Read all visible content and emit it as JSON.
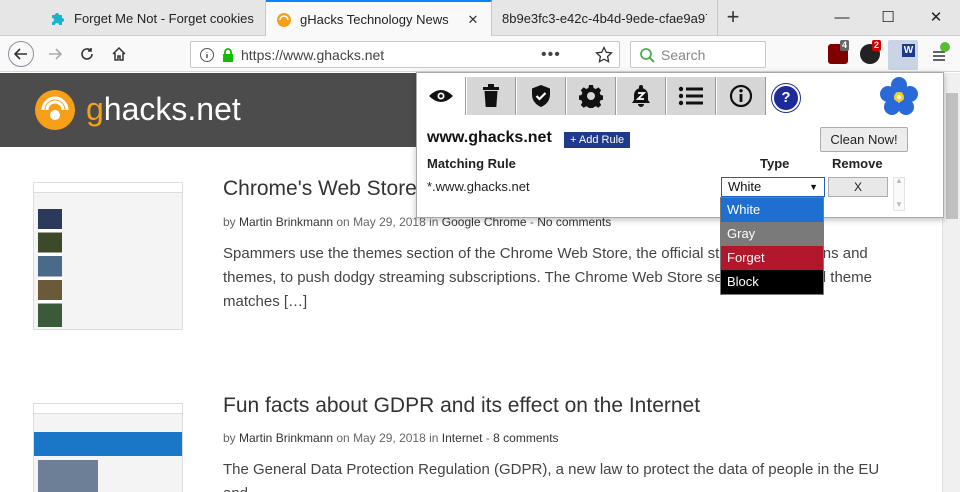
{
  "tabs": [
    {
      "title": "Forget Me Not - Forget cookies",
      "active": false
    },
    {
      "title": "gHacks Technology News",
      "active": true
    },
    {
      "title": "8b9e3fc3-e42c-4b4d-9ede-cfae9a97",
      "active": false
    }
  ],
  "toolbar": {
    "url": "https://www.ghacks.net",
    "search_placeholder": "Search",
    "badges": [
      "4",
      "2"
    ]
  },
  "site": {
    "logo_g": "g",
    "logo_rest": "hacks.net"
  },
  "articles": [
    {
      "title": "Chrome's Web Store",
      "meta_prefix": "by ",
      "author": "Martin Brinkmann",
      "meta_on": " on May 29, 2018 in ",
      "category": "Google Chrome",
      "meta_sep": " - ",
      "comments": "No comments",
      "excerpt": "Spammers use the themes section of the Chrome Web Store, the official store for extensions and themes, to push dodgy streaming subscriptions. The Chrome Web Store search option and theme matches […]"
    },
    {
      "title": "Fun facts about GDPR and its effect on the Internet",
      "meta_prefix": "by ",
      "author": "Martin Brinkmann",
      "meta_on": " on May 29, 2018 in ",
      "category": "Internet",
      "meta_sep": " - ",
      "comments": "8 comments",
      "excerpt": "The General Data Protection Regulation (GDPR), a new law to protect the data of people in the EU and"
    }
  ],
  "popup": {
    "hostname": "www.ghacks.net",
    "add_rule_label": "+ Add Rule",
    "clean_now_label": "Clean Now!",
    "col_matching_rule": "Matching Rule",
    "col_type": "Type",
    "col_remove": "Remove",
    "rule": "*.www.ghacks.net",
    "selected_type": "White",
    "remove_label": "X",
    "help_label": "?",
    "type_options": [
      {
        "label": "White",
        "bg": "#1f6fd1",
        "color": "#ffffff"
      },
      {
        "label": "Gray",
        "bg": "#7a7a7a",
        "color": "#ffffff"
      },
      {
        "label": "Forget",
        "bg": "#b3172b",
        "color": "#ffffff"
      },
      {
        "label": "Block",
        "bg": "#000000",
        "color": "#ffffff"
      }
    ]
  },
  "colors": {
    "accent": "#0a84ff",
    "header_bg": "#4c4c4c",
    "logo_orange": "#f6a01a",
    "addrule_blue": "#1f3a8c"
  }
}
